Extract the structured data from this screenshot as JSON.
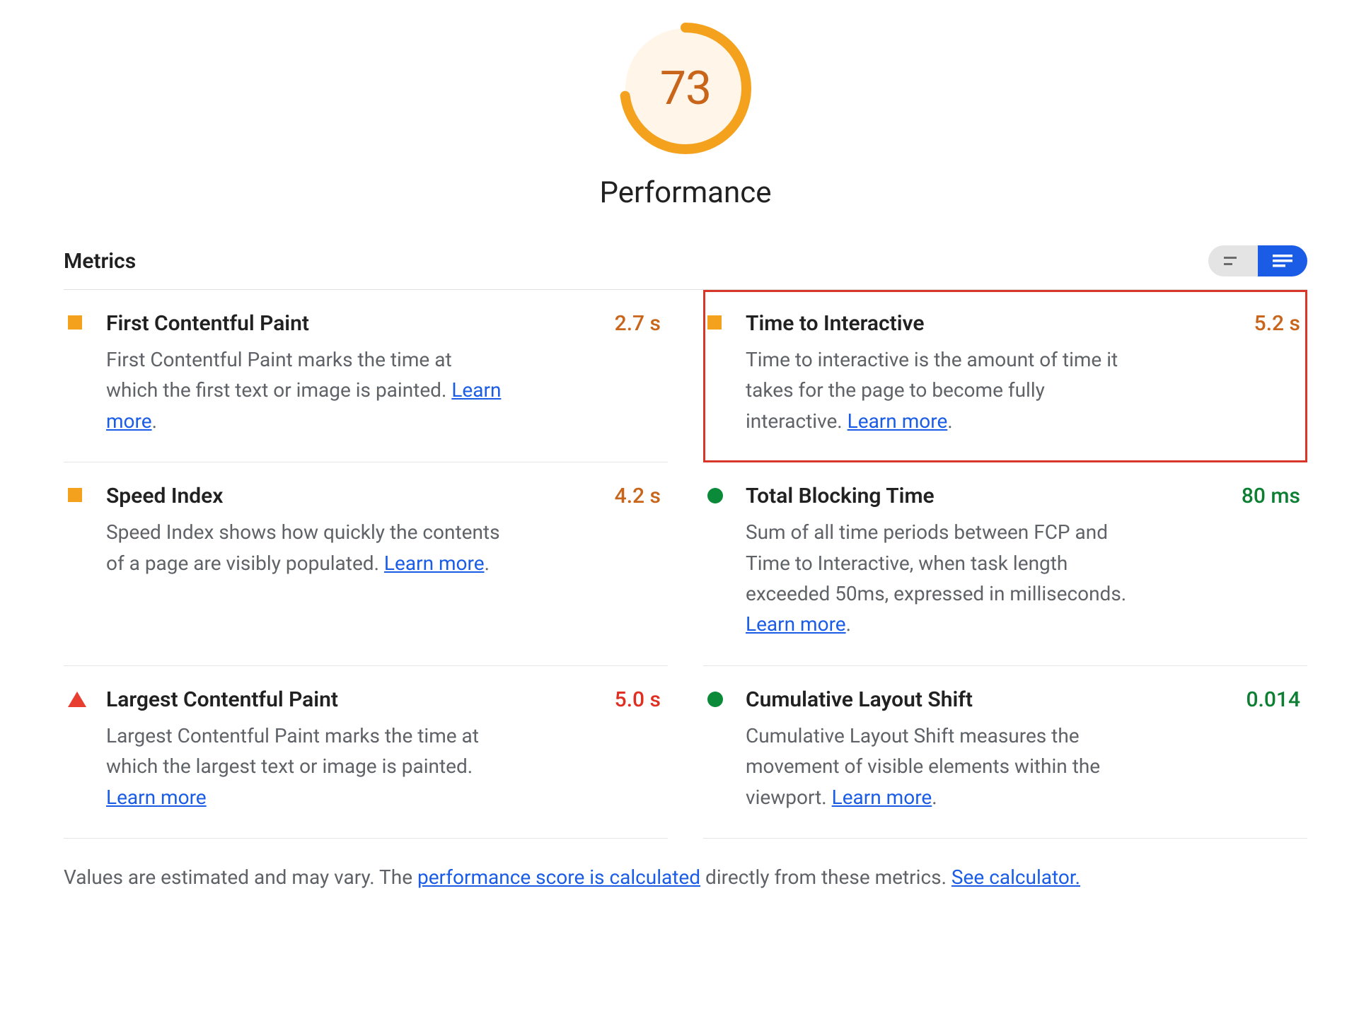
{
  "gauge": {
    "score": "73",
    "label": "Performance",
    "percent": 73,
    "color": "#F4A21E"
  },
  "metricsHeader": {
    "title": "Metrics"
  },
  "learnMore": "Learn more",
  "metrics": [
    {
      "id": "fcp",
      "name": "First Contentful Paint",
      "value": "2.7 s",
      "status": "average",
      "valueClass": "orange",
      "icon": "square",
      "highlighted": false,
      "desc_pre": "First Contentful Paint marks the time at which the first text or image is painted. ",
      "desc_post": "."
    },
    {
      "id": "tti",
      "name": "Time to Interactive",
      "value": "5.2 s",
      "status": "average",
      "valueClass": "orange",
      "icon": "square",
      "highlighted": true,
      "desc_pre": "Time to interactive is the amount of time it takes for the page to become fully interactive. ",
      "desc_post": "."
    },
    {
      "id": "si",
      "name": "Speed Index",
      "value": "4.2 s",
      "status": "average",
      "valueClass": "orange",
      "icon": "square",
      "highlighted": false,
      "desc_pre": "Speed Index shows how quickly the contents of a page are visibly populated. ",
      "desc_post": "."
    },
    {
      "id": "tbt",
      "name": "Total Blocking Time",
      "value": "80 ms",
      "status": "good",
      "valueClass": "green",
      "icon": "circle",
      "highlighted": false,
      "desc_pre": "Sum of all time periods between FCP and Time to Interactive, when task length exceeded 50ms, expressed in milliseconds. ",
      "desc_post": "."
    },
    {
      "id": "lcp",
      "name": "Largest Contentful Paint",
      "value": "5.0 s",
      "status": "poor",
      "valueClass": "red",
      "icon": "triangle",
      "highlighted": false,
      "desc_pre": "Largest Contentful Paint marks the time at which the largest text or image is painted. ",
      "desc_post": ""
    },
    {
      "id": "cls",
      "name": "Cumulative Layout Shift",
      "value": "0.014",
      "status": "good",
      "valueClass": "green",
      "icon": "circle",
      "highlighted": false,
      "desc_pre": "Cumulative Layout Shift measures the movement of visible elements within the viewport. ",
      "desc_post": "."
    }
  ],
  "footnote": {
    "pre": "Values are estimated and may vary. The ",
    "link1": "performance score is calculated",
    "mid": " directly from these metrics. ",
    "link2": "See calculator."
  }
}
